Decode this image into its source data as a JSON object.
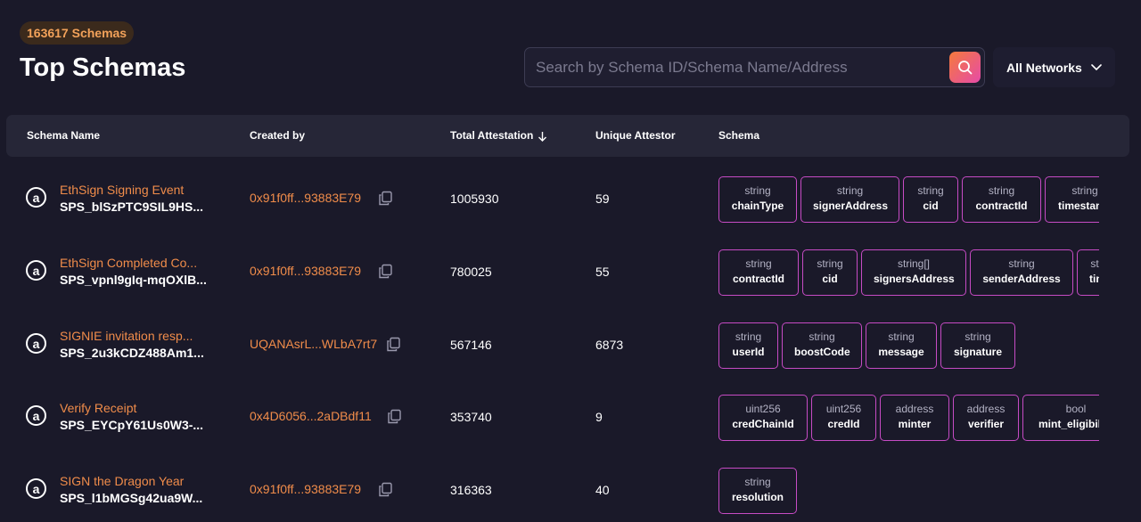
{
  "header": {
    "count_badge": "163617 Schemas",
    "title": "Top Schemas",
    "search_placeholder": "Search by Schema ID/Schema Name/Address",
    "network_label": "All Networks"
  },
  "table": {
    "columns": [
      "Schema Name",
      "Created by",
      "Total Attestation",
      "Unique Attestor",
      "Schema"
    ],
    "rows": [
      {
        "name": "EthSign Signing Event",
        "id": "SPS_blSzPTC9SIL9HS...",
        "creator": "0x91f0ff...93883E79",
        "total": "1005930",
        "unique": "59",
        "fields": [
          {
            "type": "string",
            "name": "chainType"
          },
          {
            "type": "string",
            "name": "signerAddress"
          },
          {
            "type": "string",
            "name": "cid"
          },
          {
            "type": "string",
            "name": "contractId"
          },
          {
            "type": "string",
            "name": "timestamp"
          }
        ]
      },
      {
        "name": "EthSign Completed Co...",
        "id": "SPS_vpnl9gIq-mqOXlB...",
        "creator": "0x91f0ff...93883E79",
        "total": "780025",
        "unique": "55",
        "fields": [
          {
            "type": "string",
            "name": "contractId"
          },
          {
            "type": "string",
            "name": "cid"
          },
          {
            "type": "string[]",
            "name": "signersAddress"
          },
          {
            "type": "string",
            "name": "senderAddress"
          },
          {
            "type": "string",
            "name": "timestamp"
          }
        ]
      },
      {
        "name": "SIGNIE invitation resp...",
        "id": "SPS_2u3kCDZ488Am1...",
        "creator": "UQANAsrL...WLbA7rt7",
        "total": "567146",
        "unique": "6873",
        "fields": [
          {
            "type": "string",
            "name": "userId"
          },
          {
            "type": "string",
            "name": "boostCode"
          },
          {
            "type": "string",
            "name": "message"
          },
          {
            "type": "string",
            "name": "signature"
          }
        ]
      },
      {
        "name": "Verify Receipt",
        "id": "SPS_EYCpY61Us0W3-...",
        "creator": "0x4D6056...2aDBdf11",
        "total": "353740",
        "unique": "9",
        "fields": [
          {
            "type": "uint256",
            "name": "credChainId"
          },
          {
            "type": "uint256",
            "name": "credId"
          },
          {
            "type": "address",
            "name": "minter"
          },
          {
            "type": "address",
            "name": "verifier"
          },
          {
            "type": "bool",
            "name": "mint_eligibility"
          }
        ]
      },
      {
        "name": "SIGN the Dragon Year",
        "id": "SPS_l1bMGSg42ua9W...",
        "creator": "0x91f0ff...93883E79",
        "total": "316363",
        "unique": "40",
        "fields": [
          {
            "type": "string",
            "name": "resolution"
          }
        ]
      }
    ]
  },
  "icons": {
    "search": "search-icon",
    "chevron": "chevron-down-icon",
    "sort": "arrow-down-icon",
    "copy": "copy-icon",
    "row": "attestation-logo-icon"
  },
  "colors": {
    "background": "#1a1929",
    "accent_orange": "#f08c4a",
    "tag_border": "#c64bc4",
    "header_bg": "#262637",
    "badge_text": "#f3a25a"
  }
}
